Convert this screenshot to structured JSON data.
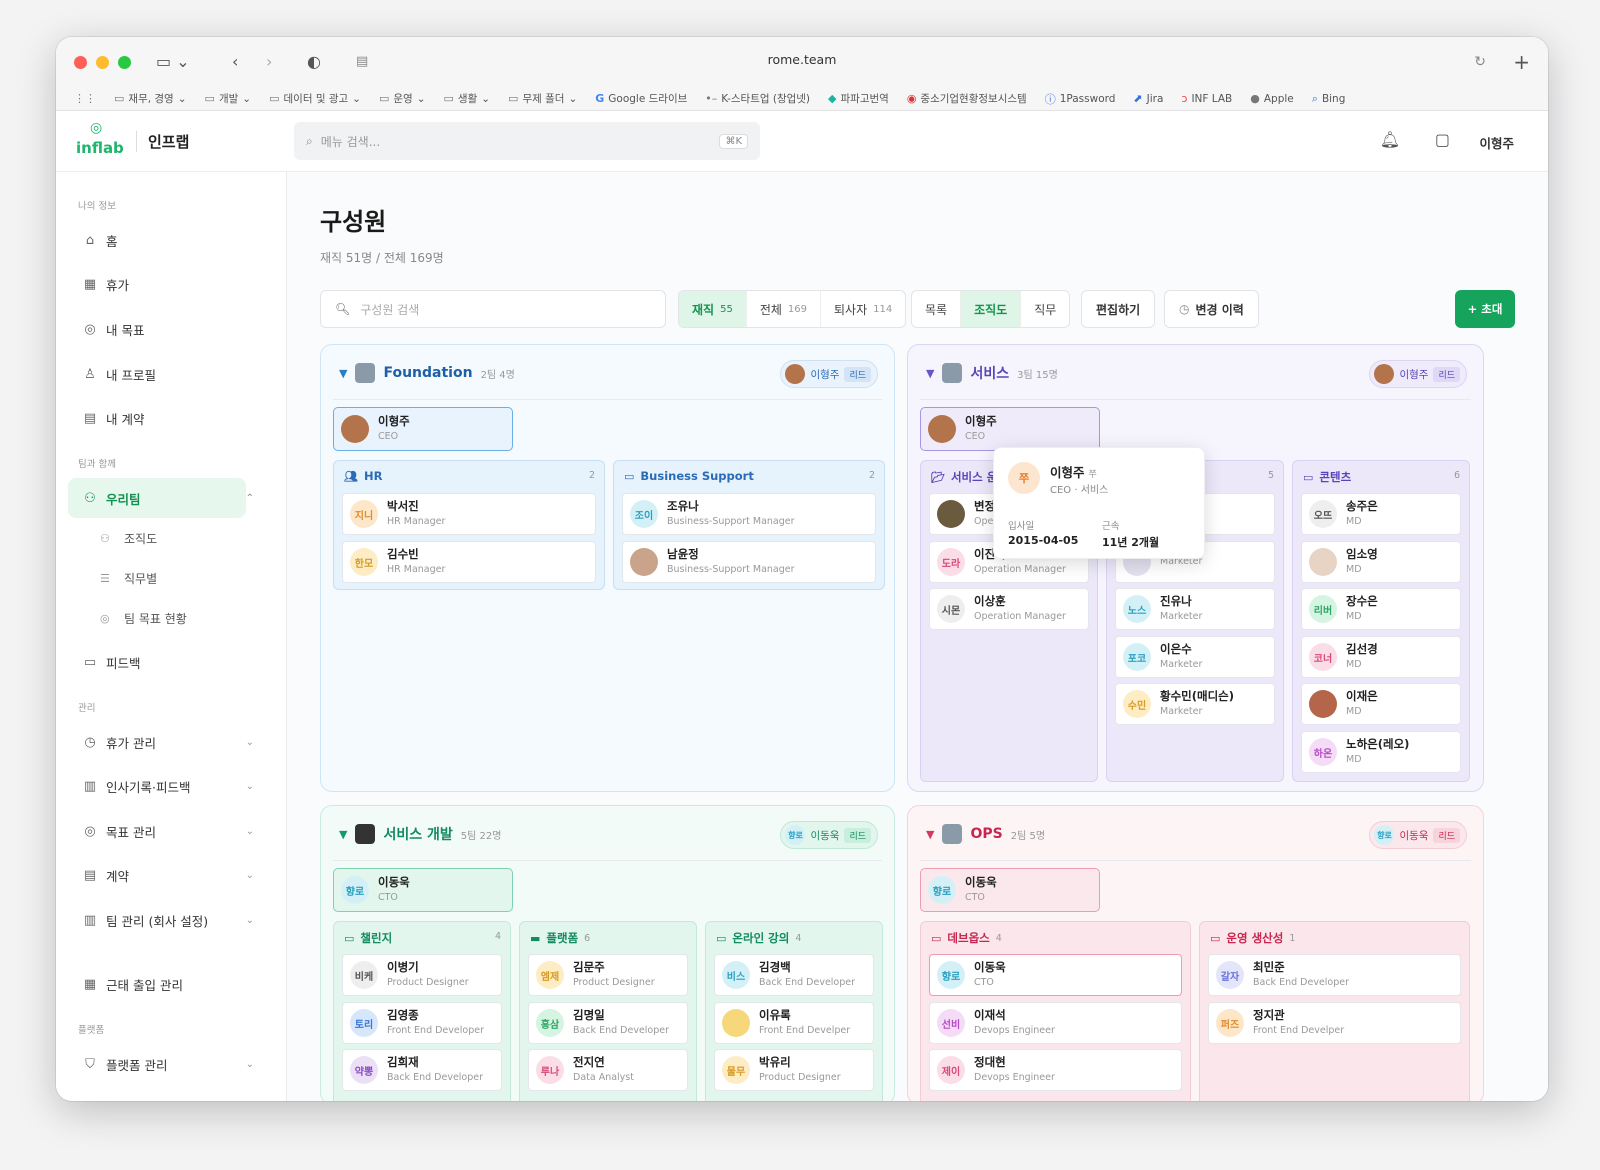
{
  "browser": {
    "url": "rome.team",
    "bookmarks": [
      "재무, 경영",
      "개발",
      "데이터 및 광고",
      "운영",
      "생활",
      "무제 폴더",
      "Google 드라이브",
      "K-스타트업 (창업넷)",
      "파파고번역",
      "중소기업현황정보시스템",
      "1Password",
      "Jira",
      "INF LAB",
      "Apple",
      "Bing"
    ]
  },
  "header": {
    "brand": "인프랩",
    "logo_text": "inflab",
    "search_placeholder": "메뉴 검색...",
    "search_kbd": "⌘K",
    "user": "이형주"
  },
  "sidebar": {
    "sec_my": "나의 정보",
    "sec_team": "팀과 함께",
    "sec_admin": "관리",
    "sec_platform": "플랫폼",
    "home": "홈",
    "vacation": "휴가",
    "my_goal": "내 목표",
    "my_profile": "내 프로필",
    "my_contract": "내 계약",
    "our_team": "우리팀",
    "org": "조직도",
    "by_job": "직무별",
    "team_goal": "팀 목표 현황",
    "feedback": "피드백",
    "vac_mgmt": "휴가 관리",
    "hr_record": "인사기록·피드백",
    "goal_mgmt": "목표 관리",
    "contract": "계약",
    "team_mgmt": "팀 관리 (회사 설정)",
    "attendance": "근태 출입 관리",
    "platform_mgmt": "플랫폼 관리"
  },
  "page": {
    "title": "구성원",
    "summary": "재직 51명 / 전체 169명",
    "search_placeholder": "구성원 검색",
    "filter": {
      "active": "재직",
      "active_n": "55",
      "all": "전체",
      "all_n": "169",
      "left": "퇴사자",
      "left_n": "114"
    },
    "view": {
      "list": "목록",
      "org": "조직도",
      "job": "직무"
    },
    "edit": "편집하기",
    "history": "변경 이력",
    "invite": "+ 초대"
  },
  "foundation": {
    "name": "Foundation",
    "meta": "2팀  4명",
    "lead": "이형주",
    "lead_tag": "리드",
    "ceo_name": "이형주",
    "ceo_role": "CEO",
    "hr": {
      "name": "HR",
      "count": "2",
      "m1_av": "지니",
      "m1_n": "박서진",
      "m1_r": "HR Manager",
      "m2_av": "한모",
      "m2_n": "김수빈",
      "m2_r": "HR Manager"
    },
    "bs": {
      "name": "Business Support",
      "count": "2",
      "m1_av": "조이",
      "m1_n": "조유나",
      "m1_r": "Business-Support Manager",
      "m2_n": "남윤정",
      "m2_r": "Business-Support Manager"
    }
  },
  "service": {
    "name": "서비스",
    "meta": "3팀  15명",
    "lead": "이형주",
    "lead_tag": "리드",
    "ceo_name": "이형주",
    "ceo_role": "CEO",
    "ops": {
      "name": "서비스 운",
      "m1_n": "변정원",
      "m1_r": "Opera",
      "m2_av": "도라",
      "m2_n": "이진국",
      "m2_r": "Operation Manager",
      "m3_av": "시몬",
      "m3_n": "이상훈",
      "m3_r": "Operation Manager"
    },
    "mkt": {
      "count": "5",
      "m1_r": "Marketer",
      "m2_av": "노스",
      "m2_n": "진유나",
      "m2_r": "Marketer",
      "m3_av": "포코",
      "m3_n": "이은수",
      "m3_r": "Marketer",
      "m4_av": "수민",
      "m4_n": "황수민(매디슨)",
      "m4_r": "Marketer"
    },
    "content": {
      "name": "콘텐츠",
      "count": "6",
      "m1_av": "오뜨",
      "m1_n": "송주은",
      "m1_r": "MD",
      "m2_n": "임소영",
      "m2_r": "MD",
      "m3_av": "리버",
      "m3_n": "장수은",
      "m3_r": "MD",
      "m4_av": "코너",
      "m4_n": "김선경",
      "m4_r": "MD",
      "m5_n": "이재은",
      "m5_r": "MD",
      "m6_av": "하온",
      "m6_n": "노하은(레오)",
      "m6_r": "MD"
    }
  },
  "popup": {
    "av": "쭈",
    "name": "이형주",
    "nick": "쭈",
    "role": "CEO · 서비스",
    "join_label": "입사일",
    "join": "2015-04-05",
    "tenure_label": "근속",
    "tenure": "11년 2개월"
  },
  "dev": {
    "name": "서비스 개발",
    "meta": "5팀  22명",
    "lead_av": "향로",
    "lead": "이동욱",
    "lead_tag": "리드",
    "cto_av": "향로",
    "cto_name": "이동욱",
    "cto_role": "CTO",
    "ch": {
      "name": "챌린지",
      "count": "4",
      "m1_av": "비케",
      "m1_n": "이병기",
      "m1_r": "Product Designer",
      "m2_av": "토리",
      "m2_n": "김영종",
      "m2_r": "Front End Developer",
      "m3_av": "약뽕",
      "m3_n": "김희재",
      "m3_r": "Back End Developer"
    },
    "pf": {
      "name": "플랫폼",
      "count": "6",
      "m1_av": "엠제",
      "m1_n": "김문주",
      "m1_r": "Product Designer",
      "m2_av": "홍삼",
      "m2_n": "김명일",
      "m2_r": "Back End Developer",
      "m3_av": "루나",
      "m3_n": "전지연",
      "m3_r": "Data Analyst"
    },
    "ol": {
      "name": "온라인 강의",
      "count": "4",
      "m1_av": "비스",
      "m1_n": "김경백",
      "m1_r": "Back End Developer",
      "m2_n": "이유록",
      "m2_r": "Front End Develper",
      "m3_av": "물무",
      "m3_n": "박유리",
      "m3_r": "Product Designer"
    }
  },
  "opsd": {
    "name": "OPS",
    "meta": "2팀  5명",
    "lead_av": "향로",
    "lead": "이동욱",
    "lead_tag": "리드",
    "cto_av": "향로",
    "cto_name": "이동욱",
    "cto_role": "CTO",
    "devops": {
      "name": "데브옵스",
      "count": "4",
      "m1_av": "향로",
      "m1_n": "이동욱",
      "m1_r": "CTO",
      "m2_av": "선비",
      "m2_n": "이재석",
      "m2_r": "Devops Engineer",
      "m3_av": "제이",
      "m3_n": "정대현",
      "m3_r": "Devops Engineer"
    },
    "prod": {
      "name": "운영 생산성",
      "count": "1",
      "m1_av": "갈자",
      "m1_n": "최민준",
      "m1_r": "Back End Developer",
      "m2_av": "퍼즈",
      "m2_n": "정지관",
      "m2_r": "Front End Develper"
    }
  }
}
